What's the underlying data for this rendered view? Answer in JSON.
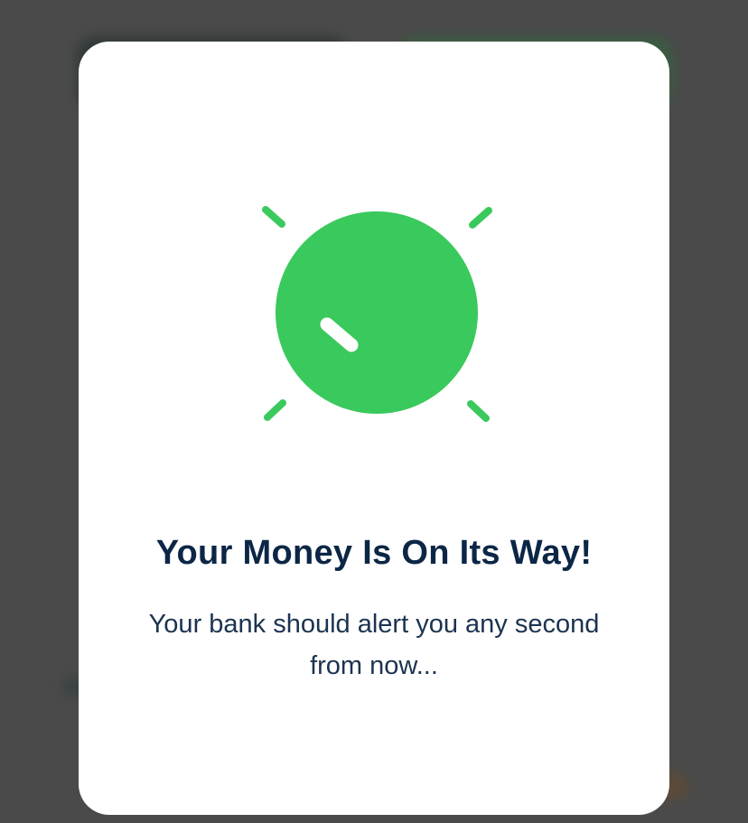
{
  "modal": {
    "title": "Your Money Is On Its Way!",
    "message": "Your bank should alert you any second from now..."
  },
  "illustration": {
    "icon": "green-bubble-sparkle-icon",
    "color": "#3ac95c",
    "highlight_color": "#ffffff"
  },
  "colors": {
    "overlay": "#4a4a4a",
    "title_text": "#0c2646",
    "body_text": "#1b3350"
  }
}
